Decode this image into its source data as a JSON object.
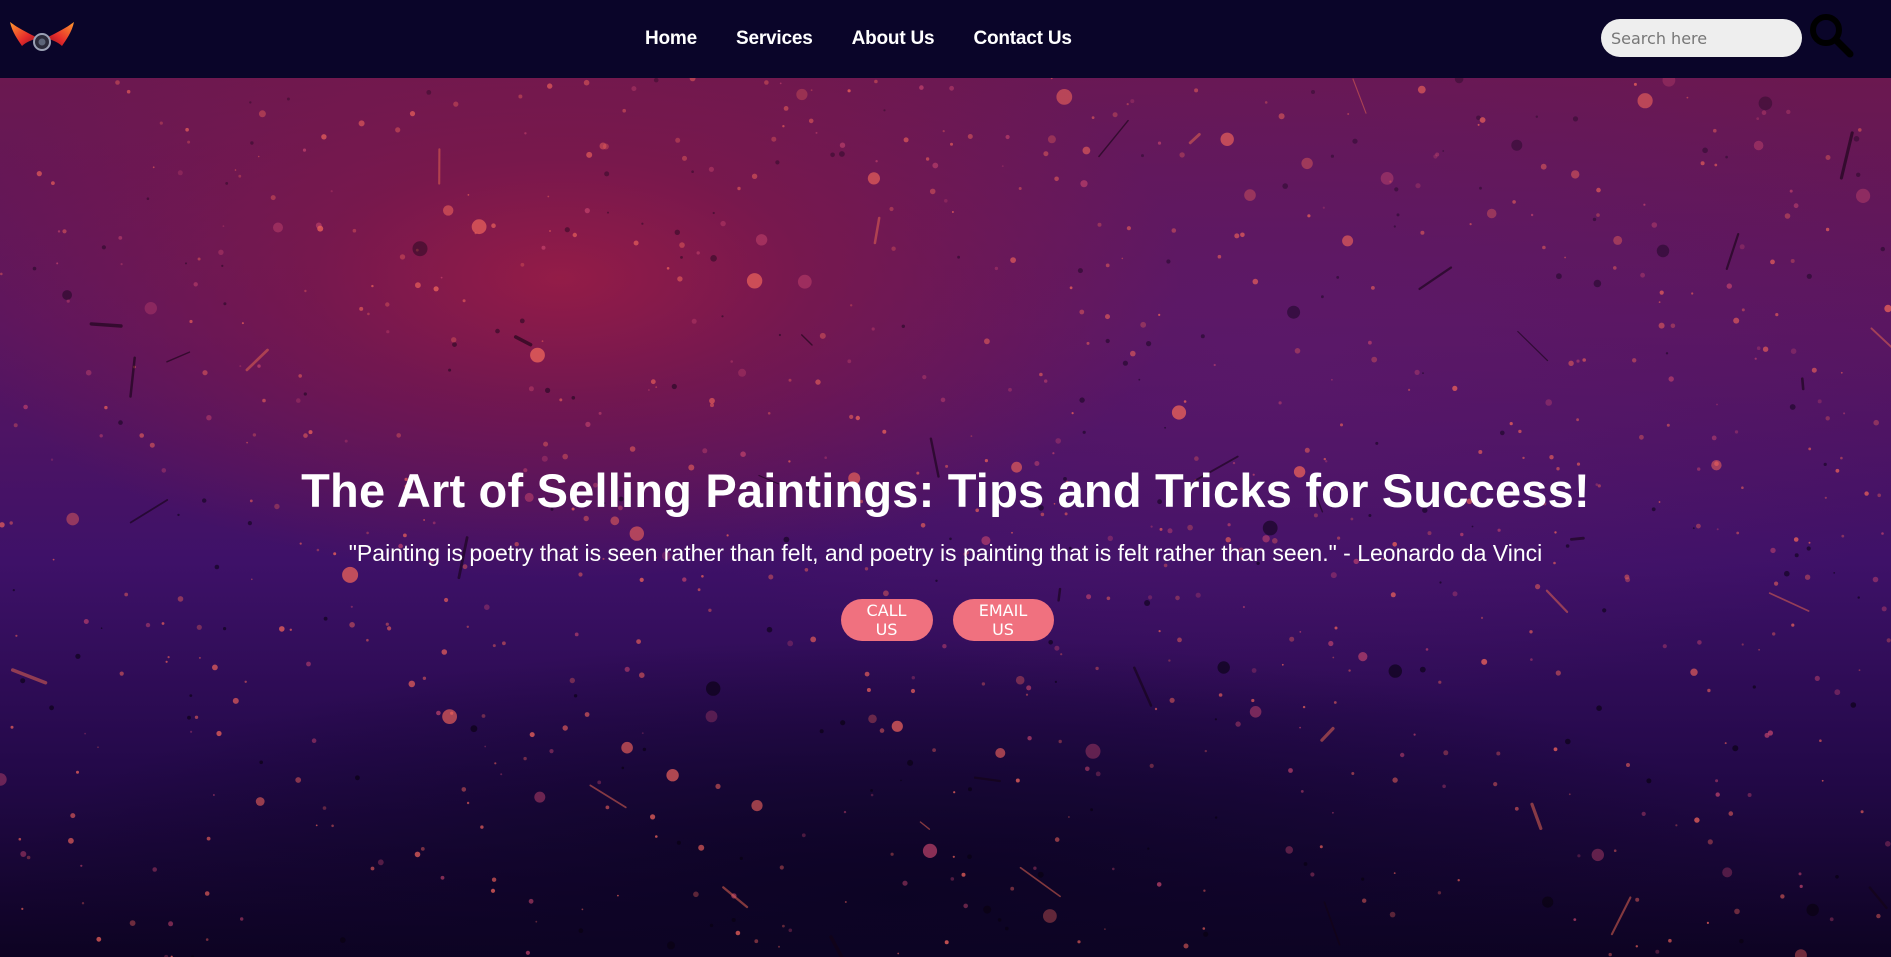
{
  "nav": {
    "logo_icon": "winged-logo-icon",
    "links": [
      "Home",
      "Services",
      "About Us",
      "Contact Us"
    ]
  },
  "search": {
    "placeholder": "Search here",
    "icon": "search-icon"
  },
  "hero": {
    "title": "The Art of Selling Paintings: Tips and Tricks for Success!",
    "quote": "\"Painting is poetry that is seen rather than felt, and poetry is painting that is felt rather than seen.\" - Leonardo da Vinci",
    "buttons": {
      "call": "CALL US",
      "email": "EMAIL US"
    },
    "background_image": "abstract-paint-splatter-background"
  },
  "colors": {
    "navbar_bg": "#0a0529",
    "button_bg": "#f0717f",
    "text": "#ffffff",
    "search_bg": "#eeeeee"
  }
}
